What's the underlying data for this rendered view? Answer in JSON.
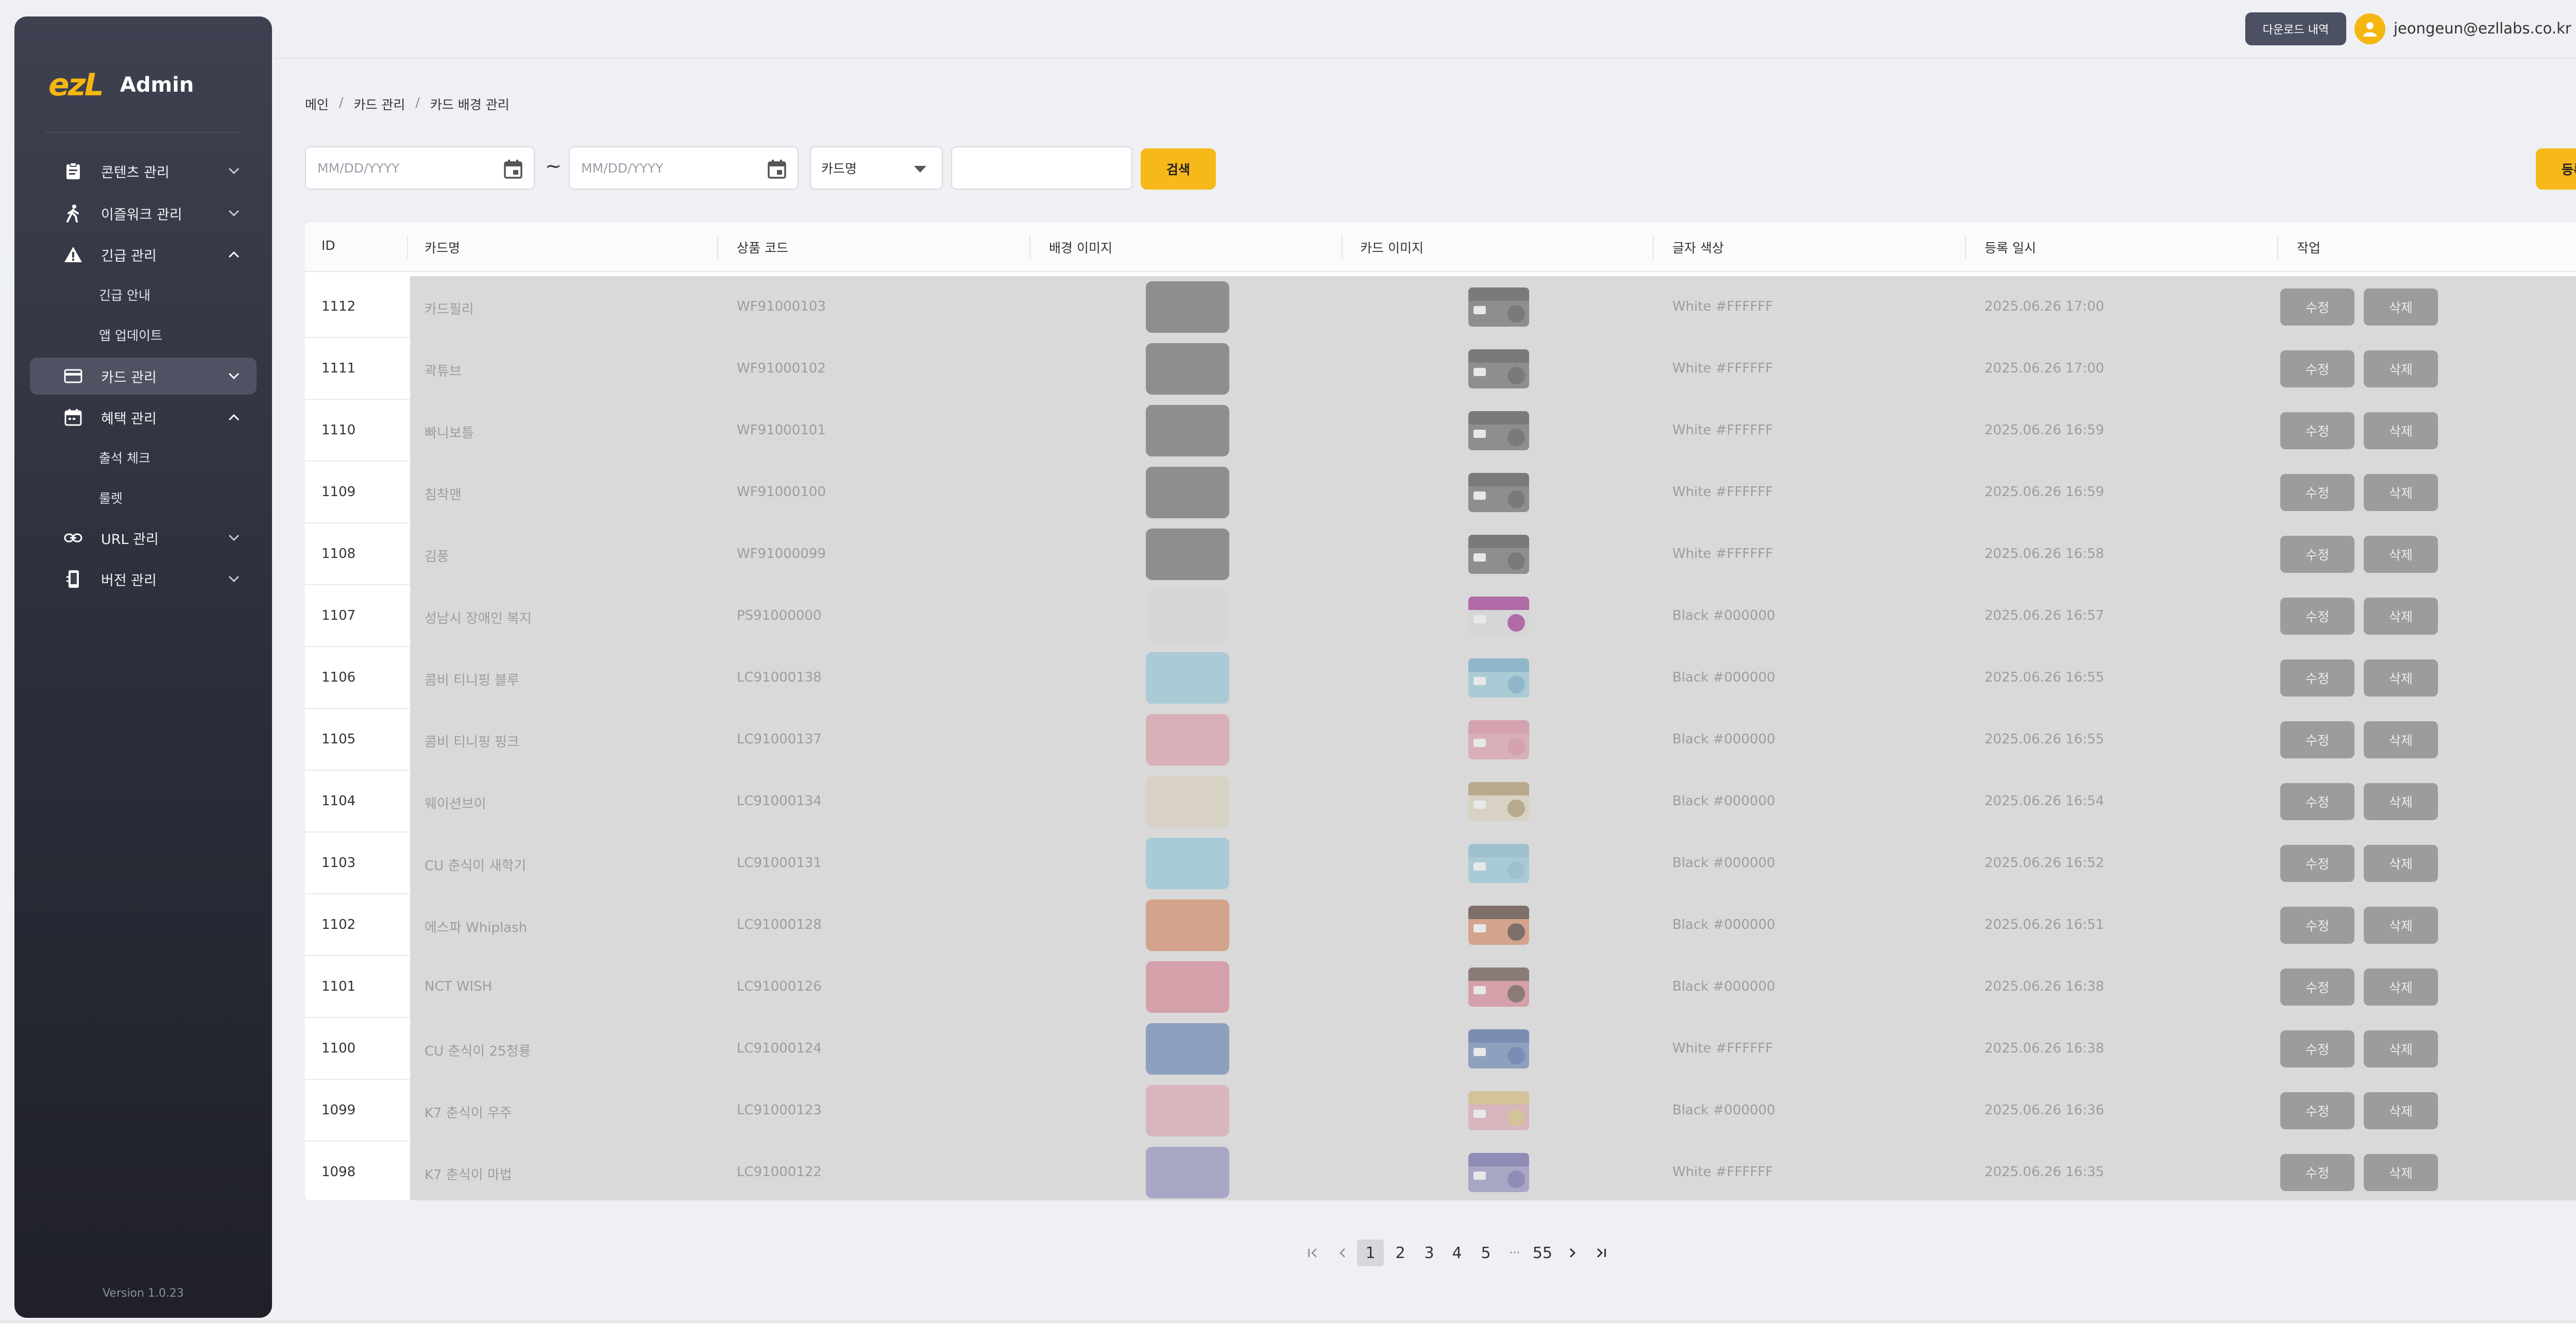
{
  "app": {
    "logo_mark": "ezL",
    "logo_text": "Admin",
    "version": "Version 1.0.23"
  },
  "sidebar": {
    "items": [
      {
        "label": "콘텐츠 관리",
        "icon": "clipboard-icon",
        "expanded": false
      },
      {
        "label": "이즐워크 관리",
        "icon": "walking-icon",
        "expanded": false
      },
      {
        "label": "긴급 관리",
        "icon": "warning-icon",
        "expanded": true,
        "children": [
          {
            "label": "긴급 안내"
          },
          {
            "label": "앱 업데이트"
          }
        ]
      },
      {
        "label": "카드 관리",
        "icon": "credit-card-icon",
        "expanded": false,
        "active": true
      },
      {
        "label": "혜택 관리",
        "icon": "calendar-icon",
        "expanded": true,
        "children": [
          {
            "label": "출석 체크"
          },
          {
            "label": "룰렛"
          }
        ]
      },
      {
        "label": "URL 관리",
        "icon": "link-icon",
        "expanded": false
      },
      {
        "label": "버전 관리",
        "icon": "phone-icon",
        "expanded": false
      }
    ]
  },
  "header": {
    "download_label": "다운로드 내역",
    "user_email": "jeongeun@ezllabs.co.kr"
  },
  "breadcrumb": [
    "메인",
    "카드 관리",
    "카드 배경 관리"
  ],
  "breadcrumb_sep": "/",
  "filters": {
    "start_date_placeholder": "MM/DD/YYYY",
    "end_date_placeholder": "MM/DD/YYYY",
    "range_separator": "~",
    "select_value": "카드명",
    "search_value": "",
    "search_label": "검색",
    "register_label": "등록"
  },
  "table": {
    "columns": [
      "ID",
      "카드명",
      "상품 코드",
      "배경 이미지",
      "카드 이미지",
      "글자 색상",
      "등록 일시",
      "작업"
    ],
    "edit_label": "수정",
    "delete_label": "삭제",
    "rows": [
      {
        "id": "1112",
        "name": "카드필리",
        "code": "WF91000103",
        "bg": "#8e8e8e",
        "band": "#7a7a7a",
        "text_color": "White #FFFFFF",
        "date": "2025.06.26 17:00"
      },
      {
        "id": "1111",
        "name": "곽튜브",
        "code": "WF91000102",
        "bg": "#8e8e8e",
        "band": "#7a7a7a",
        "text_color": "White #FFFFFF",
        "date": "2025.06.26 17:00"
      },
      {
        "id": "1110",
        "name": "빠니보틀",
        "code": "WF91000101",
        "bg": "#8e8e8e",
        "band": "#7a7a7a",
        "text_color": "White #FFFFFF",
        "date": "2025.06.26 16:59"
      },
      {
        "id": "1109",
        "name": "침착맨",
        "code": "WF91000100",
        "bg": "#8e8e8e",
        "band": "#7a7a7a",
        "text_color": "White #FFFFFF",
        "date": "2025.06.26 16:59"
      },
      {
        "id": "1108",
        "name": "김풍",
        "code": "WF91000099",
        "bg": "#8e8e8e",
        "band": "#7a7a7a",
        "text_color": "White #FFFFFF",
        "date": "2025.06.26 16:58"
      },
      {
        "id": "1107",
        "name": "성남시 장애인 복지",
        "code": "PS91000000",
        "bg": "#d6d6d6",
        "band": "#b06aa6",
        "text_color": "Black #000000",
        "date": "2025.06.26 16:57"
      },
      {
        "id": "1106",
        "name": "콤비 티니핑 블루",
        "code": "LC91000138",
        "bg": "#aacbd6",
        "band": "#8fb7c9",
        "text_color": "Black #000000",
        "date": "2025.06.26 16:55"
      },
      {
        "id": "1105",
        "name": "콤비 티니핑 핑크",
        "code": "LC91000137",
        "bg": "#d9b0b8",
        "band": "#d3a2ae",
        "text_color": "Black #000000",
        "date": "2025.06.26 16:55"
      },
      {
        "id": "1104",
        "name": "웨이션브이",
        "code": "LC91000134",
        "bg": "#d8d2c4",
        "band": "#b9a98d",
        "text_color": "Black #000000",
        "date": "2025.06.26 16:54"
      },
      {
        "id": "1103",
        "name": "CU 춘식이 새학기",
        "code": "LC91000131",
        "bg": "#a8cbd6",
        "band": "#9fc0cf",
        "text_color": "Black #000000",
        "date": "2025.06.26 16:52"
      },
      {
        "id": "1102",
        "name": "에스파 Whiplash",
        "code": "LC91000128",
        "bg": "#d3a48b",
        "band": "#7e6f6b",
        "text_color": "Black #000000",
        "date": "2025.06.26 16:51"
      },
      {
        "id": "1101",
        "name": "NCT WISH",
        "code": "LC91000126",
        "bg": "#d4a0aa",
        "band": "#8a7b78",
        "text_color": "Black #000000",
        "date": "2025.06.26 16:38"
      },
      {
        "id": "1100",
        "name": "CU 춘식이 25청룡",
        "code": "LC91000124",
        "bg": "#8ea0bd",
        "band": "#7b8db3",
        "text_color": "White #FFFFFF",
        "date": "2025.06.26 16:38"
      },
      {
        "id": "1099",
        "name": "K7 춘식이 우주",
        "code": "LC91000123",
        "bg": "#d7b6bd",
        "band": "#d3c29a",
        "text_color": "Black #000000",
        "date": "2025.06.26 16:36"
      },
      {
        "id": "1098",
        "name": "K7 춘식이 마법",
        "code": "LC91000122",
        "bg": "#a9a7c6",
        "band": "#8f8db6",
        "text_color": "White #FFFFFF",
        "date": "2025.06.26 16:35"
      }
    ]
  },
  "pagination": {
    "pages": [
      "1",
      "2",
      "3",
      "4",
      "5"
    ],
    "ellipsis": "···",
    "last_page": "55",
    "current": "1"
  },
  "colors": {
    "accent": "#f7b81a",
    "sidebar_top": "#3d4150",
    "sidebar_bottom": "#1f2029"
  }
}
